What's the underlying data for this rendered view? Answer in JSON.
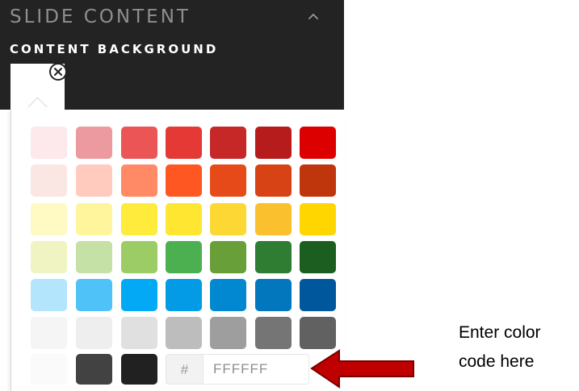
{
  "panel": {
    "section_title": "SLIDE CONTENT",
    "subsection_title": "CONTENT BACKGROUND",
    "selected_color": "#FFFFFF",
    "collapse_icon": "chevron-up-icon",
    "clear_icon": "close-circle-icon"
  },
  "palette": {
    "rows": [
      [
        "#FDE8EB",
        "#EC9A9F",
        "#EB5555",
        "#E53935",
        "#C62828",
        "#B71C1C",
        "#DD0000"
      ],
      [
        "#FAE7E3",
        "#FFCBBE",
        "#FF8A65",
        "#FF5722",
        "#E64A19",
        "#D84315",
        "#BF360C"
      ],
      [
        "#FFF9C4",
        "#FFF59D",
        "#FFEB3B",
        "#FFE631",
        "#FDD835",
        "#FBC02D",
        "#FFD600"
      ],
      [
        "#F0F4C3",
        "#C5E1A5",
        "#9CCC65",
        "#4CAF50",
        "#689F38",
        "#2E7D32",
        "#1B5E20"
      ],
      [
        "#B3E5FC",
        "#4FC3F7",
        "#03A9F4",
        "#039BE5",
        "#0288D1",
        "#0277BD",
        "#01579B"
      ],
      [
        "#F5F5F5",
        "#EEEEEE",
        "#E0E0E0",
        "#BDBDBD",
        "#9E9E9E",
        "#757575",
        "#616161"
      ],
      [
        "#FAFAFA",
        "#424242",
        "#212121"
      ]
    ]
  },
  "hex_field": {
    "prefix": "#",
    "value": "FFFFFF"
  },
  "annotation": {
    "line1": "Enter color",
    "line2": "code here",
    "arrow_color": "#C00000"
  }
}
